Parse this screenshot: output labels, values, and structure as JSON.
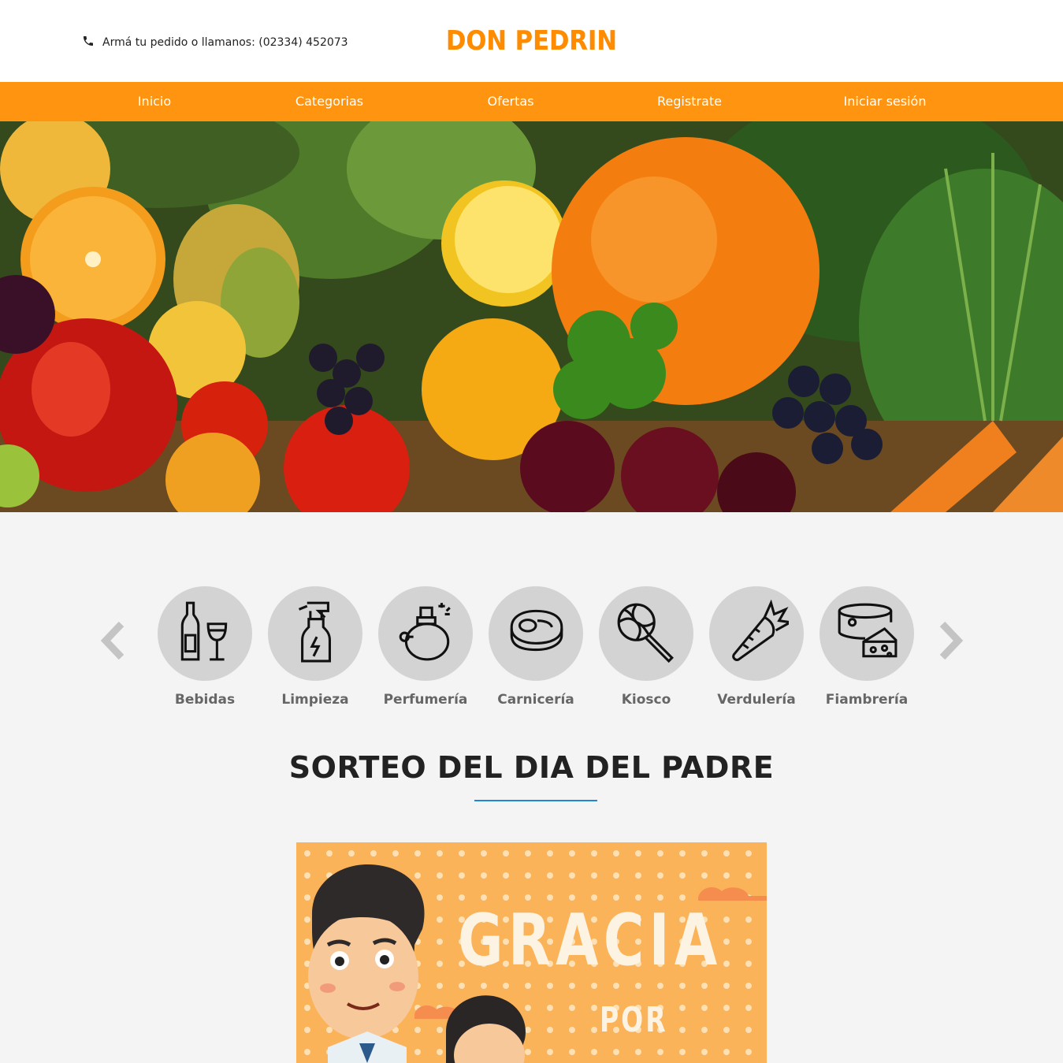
{
  "header": {
    "phone_text": "Armá tu pedido o llamanos: (02334) 452073",
    "logo_text": "DON PEDRIN",
    "brand_color": "#ff8c00"
  },
  "nav": {
    "color": "#ff9410",
    "items": [
      {
        "label": "Inicio"
      },
      {
        "label": "Categorias"
      },
      {
        "label": "Ofertas"
      },
      {
        "label": "Registrate"
      },
      {
        "label": "Iniciar sesión"
      }
    ]
  },
  "categories": {
    "prev_icon": "chevron-left-icon",
    "next_icon": "chevron-right-icon",
    "items": [
      {
        "label": "Bebidas",
        "icon": "bottle-wine-icon"
      },
      {
        "label": "Limpieza",
        "icon": "spray-bottle-icon"
      },
      {
        "label": "Perfumería",
        "icon": "perfume-icon"
      },
      {
        "label": "Carnicería",
        "icon": "steak-icon"
      },
      {
        "label": "Kiosco",
        "icon": "lollipop-icon"
      },
      {
        "label": "Verdulería",
        "icon": "carrot-icon"
      },
      {
        "label": "Fiambrería",
        "icon": "cheese-icon"
      }
    ]
  },
  "promo": {
    "title": "SORTEO DEL DIA DEL PADRE",
    "accent": "#1e88d6",
    "image_text_line1": "GRACIA",
    "image_text_line2": "POR"
  }
}
